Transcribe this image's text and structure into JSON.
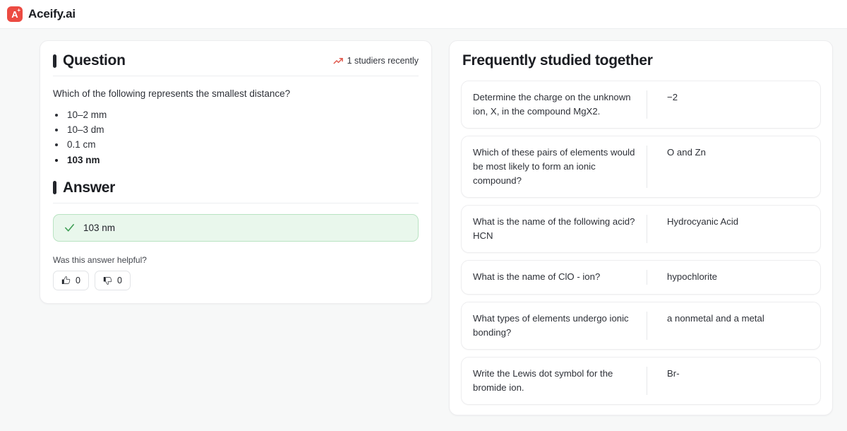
{
  "header": {
    "logo_letter": "A",
    "logo_plus": "+",
    "brand_name": "Aceify.ai"
  },
  "question_card": {
    "section_label": "Question",
    "studiers_text": "1 studiers recently",
    "prompt": "Which of the following represents the smallest distance?",
    "choices": [
      {
        "text": "10–2 mm",
        "correct": false
      },
      {
        "text": "10–3 dm",
        "correct": false
      },
      {
        "text": "0.1 cm",
        "correct": false
      },
      {
        "text": "103 nm",
        "correct": true
      }
    ],
    "answer_label": "Answer",
    "answer_value": "103 nm",
    "helpful_prompt": "Was this answer helpful?",
    "upvote_count": "0",
    "downvote_count": "0"
  },
  "related_panel": {
    "title": "Frequently studied together",
    "items": [
      {
        "question": "Determine the charge on the unknown ion, X, in the compound MgX2.",
        "answer": "−2"
      },
      {
        "question": "Which of these pairs of elements would be most likely to form an ionic compound?",
        "answer": "O and Zn"
      },
      {
        "question": "What is the name of the following acid? HCN",
        "answer": "Hydrocyanic Acid"
      },
      {
        "question": "What is the name of ClO - ion?",
        "answer": "hypochlorite"
      },
      {
        "question": "What types of elements undergo ionic bonding?",
        "answer": "a nonmetal and a metal"
      },
      {
        "question": "Write the Lewis dot symbol for the bromide ion.",
        "answer": "Br-"
      }
    ]
  },
  "colors": {
    "brand_red": "#ec4b42",
    "answer_green_bg": "#e9f7ec",
    "answer_green_border": "#b9e3c2",
    "check_green": "#3f9e55",
    "page_bg": "#f7f8f8"
  }
}
